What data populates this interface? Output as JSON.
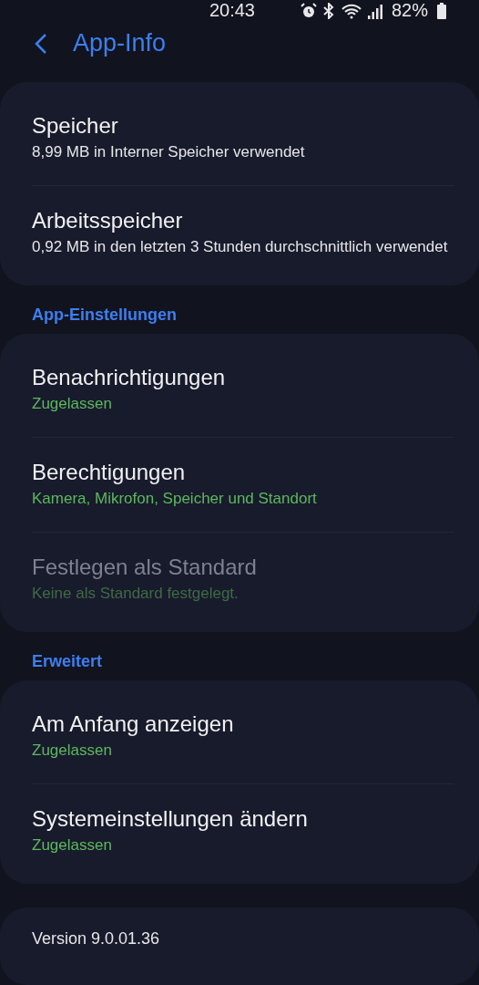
{
  "status_bar": {
    "time": "20:43",
    "battery": "82%"
  },
  "header": {
    "title": "App-Info"
  },
  "groups": [
    {
      "items": [
        {
          "title": "Speicher",
          "subtitle": "8,99 MB in Interner Speicher verwendet",
          "kind": "info",
          "disabled": false
        },
        {
          "title": "Arbeitsspeicher",
          "subtitle": "0,92 MB in den letzten 3 Stunden durchschnittlich verwendet",
          "kind": "info",
          "disabled": false
        }
      ]
    },
    {
      "heading": "App-Einstellungen",
      "items": [
        {
          "title": "Benachrichtigungen",
          "subtitle": "Zugelassen",
          "kind": "status",
          "disabled": false
        },
        {
          "title": "Berechtigungen",
          "subtitle": "Kamera, Mikrofon, Speicher und Standort",
          "kind": "status",
          "disabled": false
        },
        {
          "title": "Festlegen als Standard",
          "subtitle": "Keine als Standard festgelegt.",
          "kind": "status",
          "disabled": true
        }
      ]
    },
    {
      "heading": "Erweitert",
      "items": [
        {
          "title": "Am Anfang anzeigen",
          "subtitle": "Zugelassen",
          "kind": "status",
          "disabled": false
        },
        {
          "title": "Systemeinstellungen ändern",
          "subtitle": "Zugelassen",
          "kind": "status",
          "disabled": false
        }
      ]
    }
  ],
  "footer": {
    "version": "Version 9.0.01.36"
  }
}
